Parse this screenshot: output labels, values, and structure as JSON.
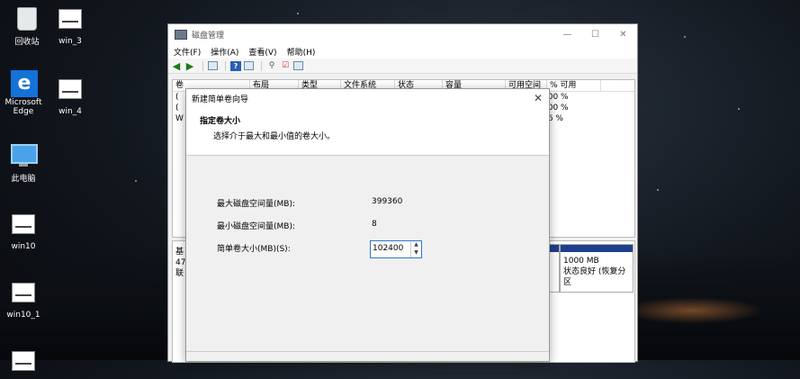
{
  "desktop": {
    "icons": [
      {
        "label": "回收站"
      },
      {
        "label": "win_3"
      },
      {
        "label": "Microsoft Edge"
      },
      {
        "label": "win_4"
      },
      {
        "label": "此电脑"
      },
      {
        "label": "win10"
      },
      {
        "label": "win10_1"
      }
    ]
  },
  "window": {
    "title": "磁盘管理",
    "controls": {
      "minimize": "—",
      "maximize": "☐",
      "close": "✕"
    },
    "menu": [
      "文件(F)",
      "操作(A)",
      "查看(V)",
      "帮助(H)"
    ],
    "columns": [
      "卷",
      "布局",
      "类型",
      "文件系统",
      "状态",
      "容量",
      "可用空间",
      "% 可用"
    ],
    "rows": [
      {
        "vol": "(",
        "pct": "100 %"
      },
      {
        "vol": "(",
        "pct": "100 %"
      },
      {
        "vol": "W",
        "pct": "56 %"
      }
    ],
    "disk": {
      "label_lines": [
        "基",
        "47",
        "联"
      ],
      "partition_size": "1000 MB",
      "partition_status": "状态良好 (恢复分区"
    }
  },
  "wizard": {
    "title": "新建简单卷向导",
    "close": "✕",
    "heading": "指定卷大小",
    "subheading": "选择介于最大和最小值的卷大小。",
    "max_label": "最大磁盘空间量(MB):",
    "max_value": "399360",
    "min_label": "最小磁盘空间量(MB):",
    "min_value": "8",
    "size_label": "简单卷大小(MB)(S):",
    "size_value": "102400"
  }
}
